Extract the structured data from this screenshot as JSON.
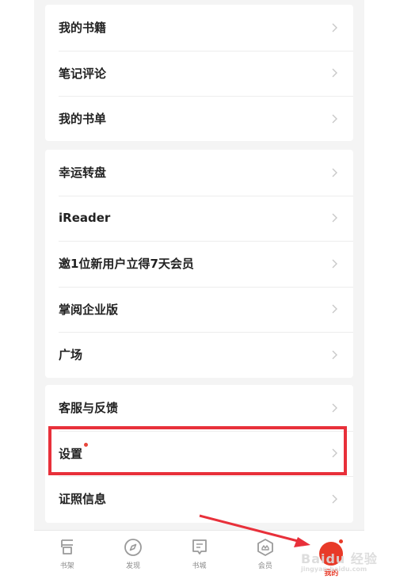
{
  "group1": {
    "items": [
      {
        "label": "我的书籍"
      },
      {
        "label": "笔记评论"
      },
      {
        "label": "我的书单"
      }
    ]
  },
  "group2": {
    "items": [
      {
        "label": "幸运转盘"
      },
      {
        "label": "iReader"
      },
      {
        "label": "邀1位新用户立得7天会员"
      },
      {
        "label": "掌阅企业版"
      },
      {
        "label": "广场"
      }
    ]
  },
  "group3": {
    "items": [
      {
        "label": "客服与反馈"
      },
      {
        "label": "设置",
        "badge": true
      },
      {
        "label": "证照信息"
      }
    ]
  },
  "tabbar": {
    "tabs": [
      {
        "label": "书架",
        "icon": "bookshelf-icon"
      },
      {
        "label": "发现",
        "icon": "compass-icon"
      },
      {
        "label": "书城",
        "icon": "bookstore-icon"
      },
      {
        "label": "会员",
        "icon": "member-icon"
      },
      {
        "label": "我的",
        "icon": "profile-icon",
        "active": true
      }
    ]
  },
  "watermark": {
    "text": "Baidu 经验",
    "sub": "jingyan.baidu.com"
  },
  "colors": {
    "accent": "#e83a28",
    "highlight": "#e8303a",
    "background": "#f4f4f4"
  }
}
